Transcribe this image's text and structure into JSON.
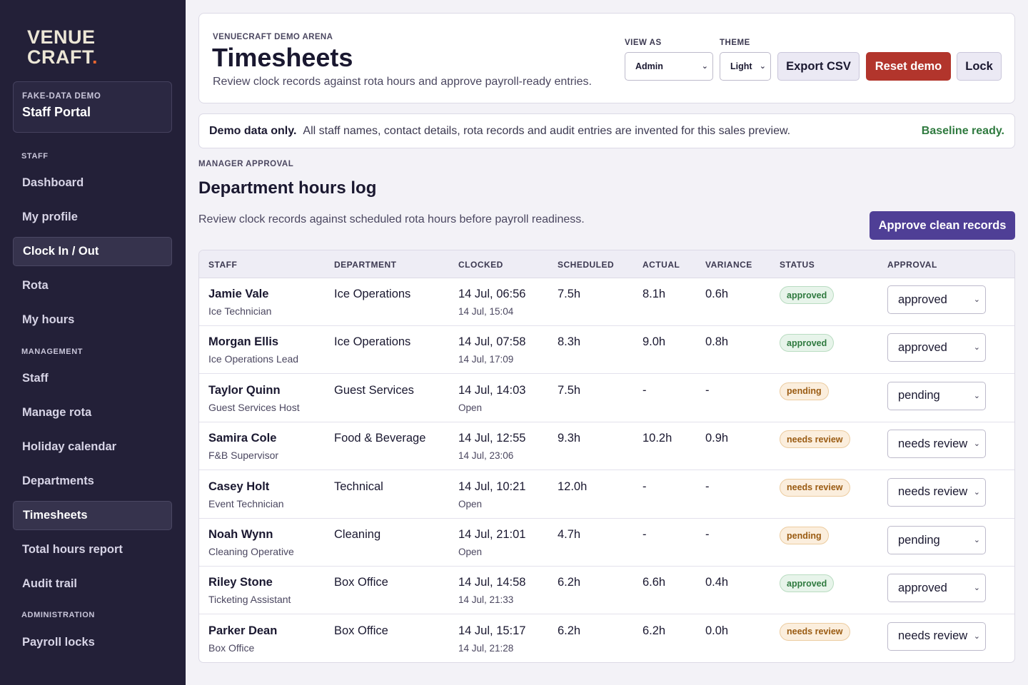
{
  "sidebar": {
    "logo_line1": "VENUE",
    "logo_line2": "CRAFT",
    "logo_dot": ".",
    "portal_kicker": "FAKE-DATA DEMO",
    "portal_title": "Staff Portal",
    "sections": {
      "staff": "STAFF",
      "management": "MANAGEMENT",
      "administration": "ADMINISTRATION"
    },
    "items": [
      {
        "label": "Dashboard",
        "active": false
      },
      {
        "label": "My profile",
        "active": false
      },
      {
        "label": "Clock In / Out",
        "active": true
      },
      {
        "label": "Rota",
        "active": false
      },
      {
        "label": "My hours",
        "active": false
      },
      {
        "label": "Staff",
        "active": false
      },
      {
        "label": "Manage rota",
        "active": false
      },
      {
        "label": "Holiday calendar",
        "active": false
      },
      {
        "label": "Departments",
        "active": false
      },
      {
        "label": "Timesheets",
        "active": true
      },
      {
        "label": "Total hours report",
        "active": false
      },
      {
        "label": "Audit trail",
        "active": false
      },
      {
        "label": "Payroll locks",
        "active": false
      }
    ]
  },
  "header": {
    "kicker": "VENUECRAFT DEMO ARENA",
    "title": "Timesheets",
    "subtitle": "Review clock records against rota hours and approve payroll-ready entries.",
    "view_as_label": "VIEW AS",
    "view_as_value": "Admin",
    "theme_label": "THEME",
    "theme_value": "Light",
    "export_label": "Export CSV",
    "reset_label": "Reset demo",
    "lock_label": "Lock"
  },
  "notice": {
    "strong": "Demo data only.",
    "text": "All staff names, contact details, rota records and audit entries are invented for this sales preview.",
    "status": "Baseline ready."
  },
  "section": {
    "kicker": "MANAGER APPROVAL",
    "title": "Department hours log",
    "subtitle": "Review clock records against scheduled rota hours before payroll readiness.",
    "approve_label": "Approve clean records"
  },
  "table": {
    "headers": [
      "STAFF",
      "DEPARTMENT",
      "CLOCKED",
      "SCHEDULED",
      "ACTUAL",
      "VARIANCE",
      "STATUS",
      "APPROVAL"
    ],
    "rows": [
      {
        "name": "Jamie Vale",
        "role": "Ice Technician",
        "department": "Ice Operations",
        "clock_in": "14 Jul, 06:56",
        "clock_out": "14 Jul, 15:04",
        "scheduled": "7.5h",
        "actual": "8.1h",
        "variance": "0.6h",
        "status": "approved",
        "approval": "approved"
      },
      {
        "name": "Morgan Ellis",
        "role": "Ice Operations Lead",
        "department": "Ice Operations",
        "clock_in": "14 Jul, 07:58",
        "clock_out": "14 Jul, 17:09",
        "scheduled": "8.3h",
        "actual": "9.0h",
        "variance": "0.8h",
        "status": "approved",
        "approval": "approved"
      },
      {
        "name": "Taylor Quinn",
        "role": "Guest Services Host",
        "department": "Guest Services",
        "clock_in": "14 Jul, 14:03",
        "clock_out": "Open",
        "scheduled": "7.5h",
        "actual": "-",
        "variance": "-",
        "status": "pending",
        "approval": "pending"
      },
      {
        "name": "Samira Cole",
        "role": "F&B Supervisor",
        "department": "Food & Beverage",
        "clock_in": "14 Jul, 12:55",
        "clock_out": "14 Jul, 23:06",
        "scheduled": "9.3h",
        "actual": "10.2h",
        "variance": "0.9h",
        "status": "needs review",
        "approval": "needs review"
      },
      {
        "name": "Casey Holt",
        "role": "Event Technician",
        "department": "Technical",
        "clock_in": "14 Jul, 10:21",
        "clock_out": "Open",
        "scheduled": "12.0h",
        "actual": "-",
        "variance": "-",
        "status": "needs review",
        "approval": "needs review"
      },
      {
        "name": "Noah Wynn",
        "role": "Cleaning Operative",
        "department": "Cleaning",
        "clock_in": "14 Jul, 21:01",
        "clock_out": "Open",
        "scheduled": "4.7h",
        "actual": "-",
        "variance": "-",
        "status": "pending",
        "approval": "pending"
      },
      {
        "name": "Riley Stone",
        "role": "Ticketing Assistant",
        "department": "Box Office",
        "clock_in": "14 Jul, 14:58",
        "clock_out": "14 Jul, 21:33",
        "scheduled": "6.2h",
        "actual": "6.6h",
        "variance": "0.4h",
        "status": "approved",
        "approval": "approved"
      },
      {
        "name": "Parker Dean",
        "role": "Box Office",
        "department": "Box Office",
        "clock_in": "14 Jul, 15:17",
        "clock_out": "14 Jul, 21:28",
        "scheduled": "6.2h",
        "actual": "6.2h",
        "variance": "0.0h",
        "status": "needs review",
        "approval": "needs review"
      }
    ]
  },
  "colors": {
    "sidebar_bg": "#232038",
    "accent_purple": "#4f3f96",
    "danger_red": "#b2352c",
    "success_green": "#2f7a3f",
    "warning_amber": "#9a5b12",
    "logo_dot": "#e8662f"
  },
  "icons": {
    "select_chevron": "chevron-down-icon"
  }
}
